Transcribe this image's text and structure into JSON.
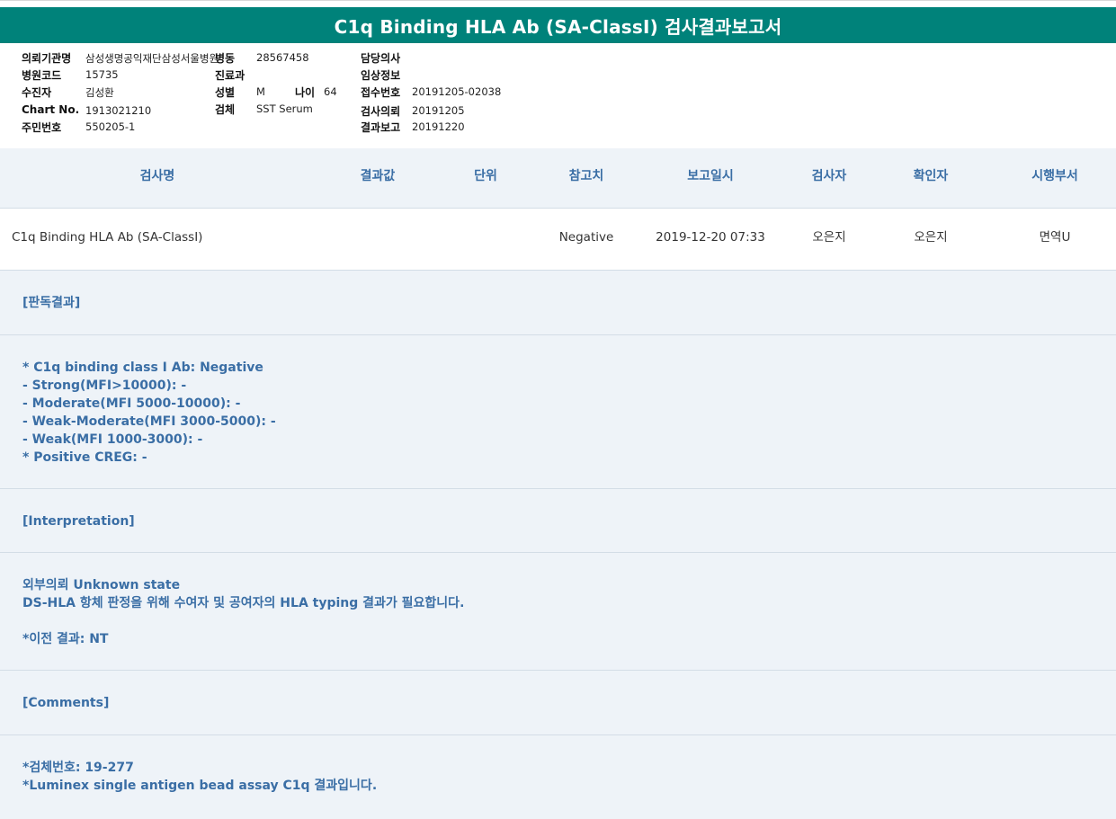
{
  "report": {
    "title": "C1q Binding HLA Ab (SA-ClassI) 검사결과보고서"
  },
  "patient_info": {
    "institution_label": "의뢰기관명",
    "institution_value": "삼성생명공익재단삼성서울병원",
    "ward_label": "병동",
    "ward_value": "28567458",
    "doctor_label": "담당의사",
    "doctor_value": "",
    "hospital_code_label": "병원코드",
    "hospital_code_value": "15735",
    "department_label": "진료과",
    "department_value": "",
    "clinical_label": "임상정보",
    "clinical_value": "",
    "patient_label": "수진자",
    "patient_value": "김성환",
    "sex_label": "성별",
    "sex_value": "M",
    "age_label": "나이",
    "age_value": "64",
    "receipt_label": "접수번호",
    "receipt_value": "20191205-02038",
    "chart_label": "Chart No.",
    "chart_value": "1913021210",
    "specimen_label": "검체",
    "specimen_value": "SST Serum",
    "request_label": "검사의뢰",
    "request_value": "20191205",
    "id_label": "주민번호",
    "id_value": "550205-1",
    "result_report_label": "결과보고",
    "result_report_value": "20191220"
  },
  "table": {
    "headers": [
      "검사명",
      "결과값",
      "단위",
      "참고치",
      "보고일시",
      "검사자",
      "확인자",
      "시행부서"
    ],
    "row": {
      "test_name": "C1q Binding HLA Ab (SA-ClassI)",
      "result": "",
      "unit": "",
      "reference": "Negative",
      "report_datetime": "2019-12-20 07:33",
      "examiner": "오은지",
      "confirmer": "오은지",
      "department": "면역U"
    }
  },
  "sections": {
    "judgement_title": "[판독결과]",
    "judgement_lines": [
      "* C1q binding class I Ab: Negative",
      "- Strong(MFI>10000): -",
      "- Moderate(MFI 5000-10000): -",
      "- Weak-Moderate(MFI 3000-5000): -",
      "- Weak(MFI 1000-3000): -",
      "* Positive CREG: -"
    ],
    "interpretation_title": "[Interpretation]",
    "interpretation_lines": [
      "외부의뢰 Unknown state",
      "DS-HLA 항체 판정을 위해 수여자 및 공여자의 HLA typing 결과가 필요합니다.",
      "",
      "*이전 결과: NT"
    ],
    "comments_title": "[Comments]",
    "comments_lines": [
      "*검체번호: 19-277",
      "*Luminex single antigen bead assay C1q 결과입니다."
    ]
  }
}
